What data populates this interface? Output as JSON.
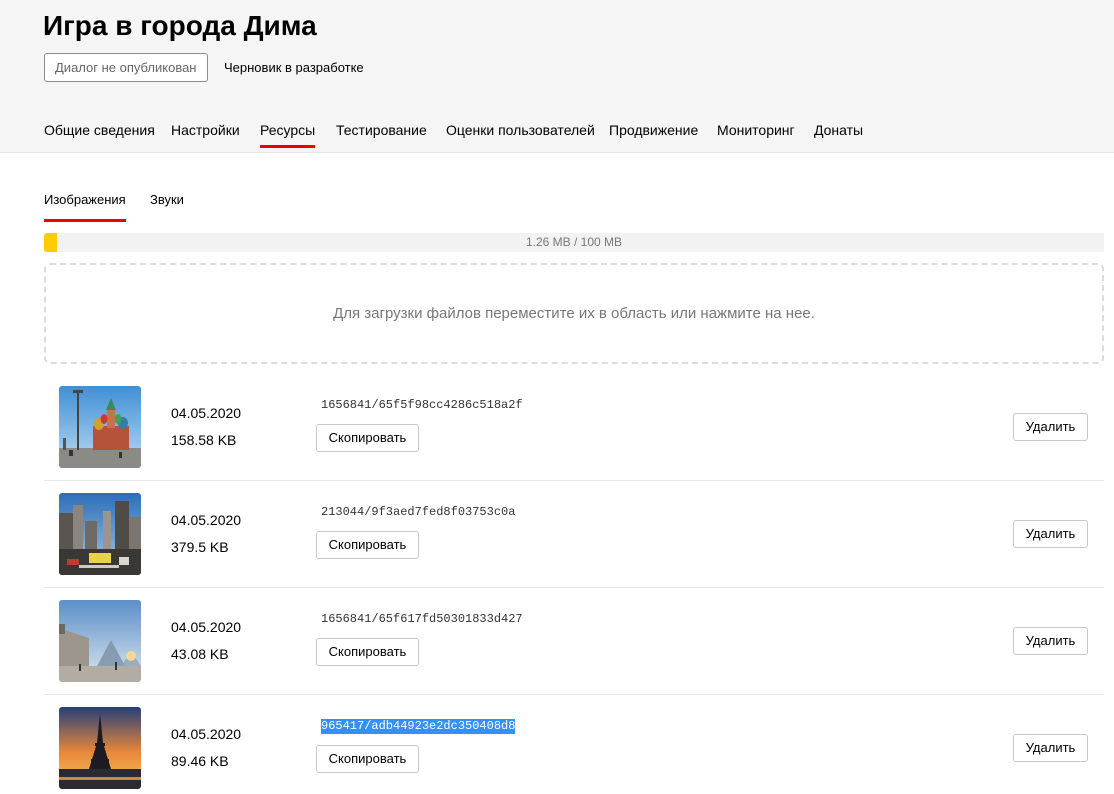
{
  "page": {
    "title": "Игра в города Дима",
    "status_badge": "Диалог не опубликован",
    "status_note": "Черновик в разработке"
  },
  "main_tabs": [
    {
      "label": "Общие сведения",
      "active": false
    },
    {
      "label": "Настройки",
      "active": false
    },
    {
      "label": "Ресурсы",
      "active": true
    },
    {
      "label": "Тестирование",
      "active": false
    },
    {
      "label": "Оценки пользователей",
      "active": false
    },
    {
      "label": "Продвижение",
      "active": false
    },
    {
      "label": "Мониторинг",
      "active": false
    },
    {
      "label": "Донаты",
      "active": false
    }
  ],
  "sub_tabs": [
    {
      "label": "Изображения",
      "active": true
    },
    {
      "label": "Звуки",
      "active": false
    }
  ],
  "quota": {
    "text": "1.26 MB / 100 MB",
    "used_percent": 1.26
  },
  "dropzone": {
    "text": "Для загрузки файлов переместите их в область или нажмите на нее."
  },
  "buttons": {
    "copy_label": "Скопировать",
    "delete_label": "Удалить"
  },
  "files": [
    {
      "date": "04.05.2020",
      "size": "158.58 KB",
      "id": "1656841/65f5f98cc4286c518a2f",
      "thumb": "moscow-st-basils",
      "selected": false
    },
    {
      "date": "04.05.2020",
      "size": "379.5 KB",
      "id": "213044/9f3aed7fed8f03753c0a",
      "thumb": "new-york-street",
      "selected": false
    },
    {
      "date": "04.05.2020",
      "size": "43.08 KB",
      "id": "1656841/65f617fd50301833d427",
      "thumb": "paris-louvre",
      "selected": false
    },
    {
      "date": "04.05.2020",
      "size": "89.46 KB",
      "id": "965417/adb44923e2dc350408d8",
      "thumb": "paris-eiffel-tower",
      "selected": true
    }
  ],
  "colors": {
    "accent": "#e00000",
    "quota_fill": "#ffcc00",
    "selection": "#3390ff"
  }
}
